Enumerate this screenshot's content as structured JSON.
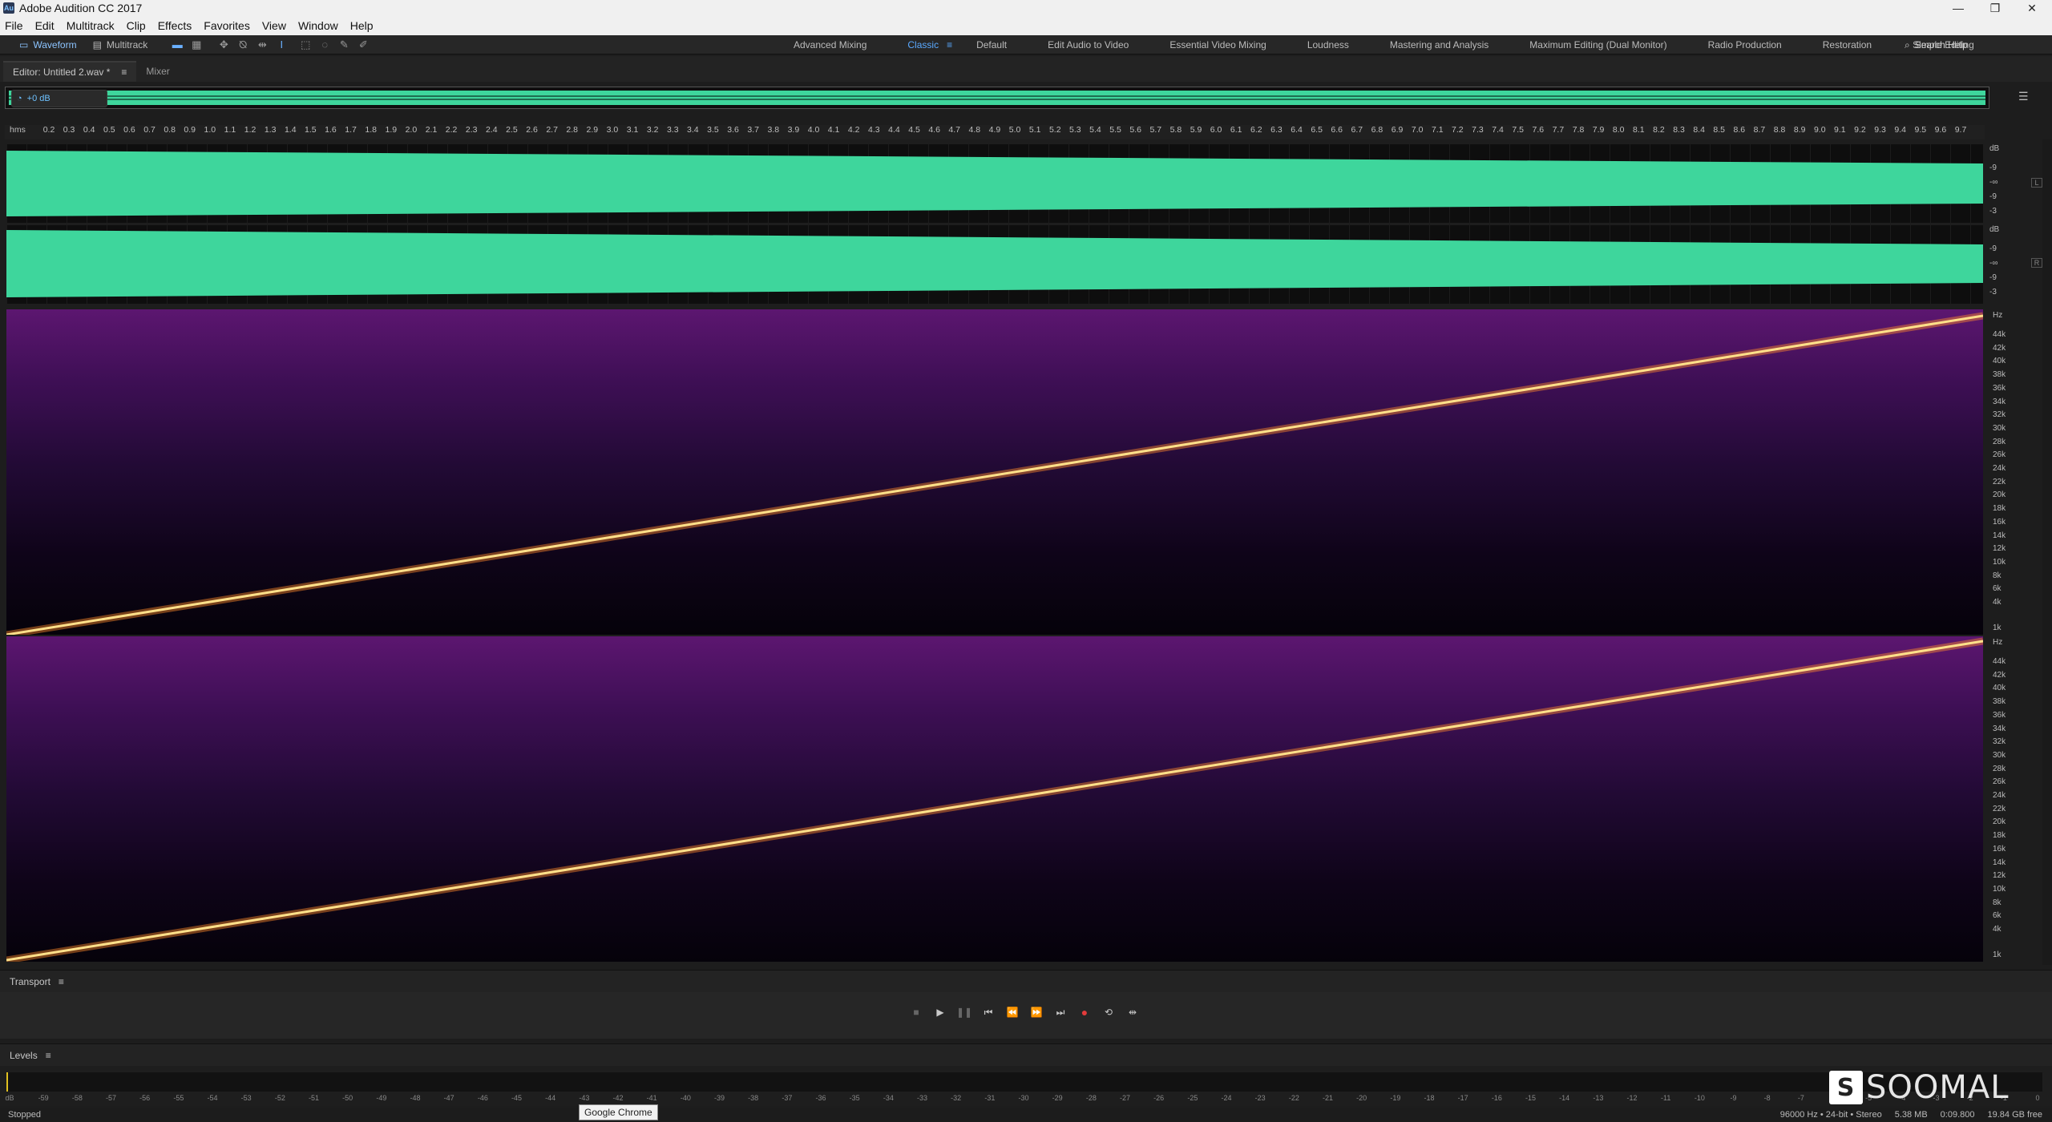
{
  "window": {
    "title": "Adobe Audition CC 2017",
    "icon_text": "Au",
    "controls": [
      "minimize",
      "restore",
      "close"
    ]
  },
  "menu": [
    "File",
    "Edit",
    "Multitrack",
    "Clip",
    "Effects",
    "Favorites",
    "View",
    "Window",
    "Help"
  ],
  "toolbar": {
    "waveform_label": "Waveform",
    "multitrack_label": "Multitrack",
    "workspaces": [
      "Advanced Mixing",
      "Classic",
      "Default",
      "Edit Audio to Video",
      "Essential Video Mixing",
      "Loudness",
      "Mastering and Analysis",
      "Maximum Editing (Dual Monitor)",
      "Radio Production",
      "Restoration",
      "Simple Editing"
    ],
    "active_workspace": "Classic",
    "search_placeholder": "Search Help"
  },
  "editor": {
    "tab_label": "Editor: Untitled 2.wav *",
    "mixer_label": "Mixer",
    "hud_value": "+0 dB",
    "wave_color": "#3ed69c"
  },
  "ruler": {
    "unit": "hms",
    "ticks": [
      "0.2",
      "0.3",
      "0.4",
      "0.5",
      "0.6",
      "0.7",
      "0.8",
      "0.9",
      "1.0",
      "1.1",
      "1.2",
      "1.3",
      "1.4",
      "1.5",
      "1.6",
      "1.7",
      "1.8",
      "1.9",
      "2.0",
      "2.1",
      "2.2",
      "2.3",
      "2.4",
      "2.5",
      "2.6",
      "2.7",
      "2.8",
      "2.9",
      "3.0",
      "3.1",
      "3.2",
      "3.3",
      "3.4",
      "3.5",
      "3.6",
      "3.7",
      "3.8",
      "3.9",
      "4.0",
      "4.1",
      "4.2",
      "4.3",
      "4.4",
      "4.5",
      "4.6",
      "4.7",
      "4.8",
      "4.9",
      "5.0",
      "5.1",
      "5.2",
      "5.3",
      "5.4",
      "5.5",
      "5.6",
      "5.7",
      "5.8",
      "5.9",
      "6.0",
      "6.1",
      "6.2",
      "6.3",
      "6.4",
      "6.5",
      "6.6",
      "6.7",
      "6.8",
      "6.9",
      "7.0",
      "7.1",
      "7.2",
      "7.3",
      "7.4",
      "7.5",
      "7.6",
      "7.7",
      "7.8",
      "7.9",
      "8.0",
      "8.1",
      "8.2",
      "8.3",
      "8.4",
      "8.5",
      "8.6",
      "8.7",
      "8.8",
      "8.9",
      "9.0",
      "9.1",
      "9.2",
      "9.3",
      "9.4",
      "9.5",
      "9.6",
      "9.7"
    ]
  },
  "db_scale": {
    "unit": "dB",
    "labels": [
      "-9",
      "-∞",
      "-9",
      "-3"
    ]
  },
  "channels": {
    "left": "L",
    "right": "R"
  },
  "hz_scale": {
    "unit": "Hz",
    "labels": [
      "44k",
      "42k",
      "40k",
      "38k",
      "36k",
      "34k",
      "32k",
      "30k",
      "28k",
      "26k",
      "24k",
      "22k",
      "20k",
      "18k",
      "16k",
      "14k",
      "12k",
      "10k",
      "8k",
      "6k",
      "4k",
      "1k"
    ]
  },
  "transport": {
    "title": "Transport",
    "buttons": [
      "stop",
      "play",
      "pause",
      "move-to-previous",
      "rewind",
      "fast-forward",
      "move-to-next",
      "record",
      "play-from-start",
      "skip-silence"
    ]
  },
  "levels": {
    "title": "Levels",
    "scale": [
      "dB",
      "-59",
      "-58",
      "-57",
      "-56",
      "-55",
      "-54",
      "-53",
      "-52",
      "-51",
      "-50",
      "-49",
      "-48",
      "-47",
      "-46",
      "-45",
      "-44",
      "-43",
      "-42",
      "-41",
      "-40",
      "-39",
      "-38",
      "-37",
      "-36",
      "-35",
      "-34",
      "-33",
      "-32",
      "-31",
      "-30",
      "-29",
      "-28",
      "-27",
      "-26",
      "-25",
      "-24",
      "-23",
      "-22",
      "-21",
      "-20",
      "-19",
      "-18",
      "-17",
      "-16",
      "-15",
      "-14",
      "-13",
      "-12",
      "-11",
      "-10",
      "-9",
      "-8",
      "-7",
      "-6",
      "-5",
      "-4",
      "-3",
      "-2",
      "-1",
      "0"
    ]
  },
  "status": {
    "state": "Stopped",
    "tooltip": "Google Chrome",
    "sample_info": "96000 Hz • 24-bit • Stereo",
    "file_size": "5.38 MB",
    "duration": "0:09.800",
    "free_space": "19.84 GB free"
  },
  "watermark": {
    "text": "SOOMAL",
    "logo_letter": "S"
  }
}
